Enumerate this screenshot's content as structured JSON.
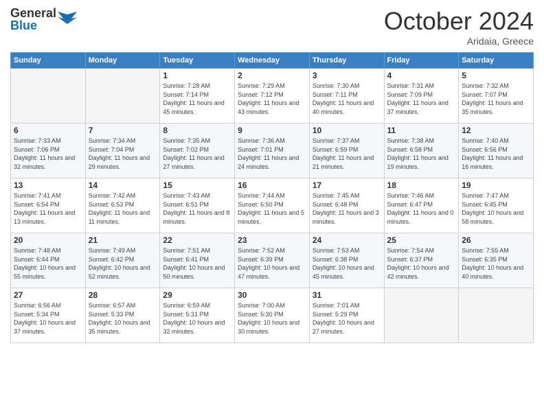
{
  "header": {
    "logo_general": "General",
    "logo_blue": "Blue",
    "month_title": "October 2024",
    "location": "Aridaia, Greece"
  },
  "days_of_week": [
    "Sunday",
    "Monday",
    "Tuesday",
    "Wednesday",
    "Thursday",
    "Friday",
    "Saturday"
  ],
  "weeks": [
    [
      {
        "num": "",
        "info": ""
      },
      {
        "num": "",
        "info": ""
      },
      {
        "num": "1",
        "info": "Sunrise: 7:28 AM\nSunset: 7:14 PM\nDaylight: 11 hours and 45 minutes."
      },
      {
        "num": "2",
        "info": "Sunrise: 7:29 AM\nSunset: 7:12 PM\nDaylight: 11 hours and 43 minutes."
      },
      {
        "num": "3",
        "info": "Sunrise: 7:30 AM\nSunset: 7:11 PM\nDaylight: 11 hours and 40 minutes."
      },
      {
        "num": "4",
        "info": "Sunrise: 7:31 AM\nSunset: 7:09 PM\nDaylight: 11 hours and 37 minutes."
      },
      {
        "num": "5",
        "info": "Sunrise: 7:32 AM\nSunset: 7:07 PM\nDaylight: 11 hours and 35 minutes."
      }
    ],
    [
      {
        "num": "6",
        "info": "Sunrise: 7:33 AM\nSunset: 7:06 PM\nDaylight: 11 hours and 32 minutes."
      },
      {
        "num": "7",
        "info": "Sunrise: 7:34 AM\nSunset: 7:04 PM\nDaylight: 11 hours and 29 minutes."
      },
      {
        "num": "8",
        "info": "Sunrise: 7:35 AM\nSunset: 7:02 PM\nDaylight: 11 hours and 27 minutes."
      },
      {
        "num": "9",
        "info": "Sunrise: 7:36 AM\nSunset: 7:01 PM\nDaylight: 11 hours and 24 minutes."
      },
      {
        "num": "10",
        "info": "Sunrise: 7:37 AM\nSunset: 6:59 PM\nDaylight: 11 hours and 21 minutes."
      },
      {
        "num": "11",
        "info": "Sunrise: 7:38 AM\nSunset: 6:58 PM\nDaylight: 11 hours and 19 minutes."
      },
      {
        "num": "12",
        "info": "Sunrise: 7:40 AM\nSunset: 6:56 PM\nDaylight: 11 hours and 16 minutes."
      }
    ],
    [
      {
        "num": "13",
        "info": "Sunrise: 7:41 AM\nSunset: 6:54 PM\nDaylight: 11 hours and 13 minutes."
      },
      {
        "num": "14",
        "info": "Sunrise: 7:42 AM\nSunset: 6:53 PM\nDaylight: 11 hours and 11 minutes."
      },
      {
        "num": "15",
        "info": "Sunrise: 7:43 AM\nSunset: 6:51 PM\nDaylight: 11 hours and 8 minutes."
      },
      {
        "num": "16",
        "info": "Sunrise: 7:44 AM\nSunset: 6:50 PM\nDaylight: 11 hours and 5 minutes."
      },
      {
        "num": "17",
        "info": "Sunrise: 7:45 AM\nSunset: 6:48 PM\nDaylight: 11 hours and 3 minutes."
      },
      {
        "num": "18",
        "info": "Sunrise: 7:46 AM\nSunset: 6:47 PM\nDaylight: 11 hours and 0 minutes."
      },
      {
        "num": "19",
        "info": "Sunrise: 7:47 AM\nSunset: 6:45 PM\nDaylight: 10 hours and 58 minutes."
      }
    ],
    [
      {
        "num": "20",
        "info": "Sunrise: 7:48 AM\nSunset: 6:44 PM\nDaylight: 10 hours and 55 minutes."
      },
      {
        "num": "21",
        "info": "Sunrise: 7:49 AM\nSunset: 6:42 PM\nDaylight: 10 hours and 52 minutes."
      },
      {
        "num": "22",
        "info": "Sunrise: 7:51 AM\nSunset: 6:41 PM\nDaylight: 10 hours and 50 minutes."
      },
      {
        "num": "23",
        "info": "Sunrise: 7:52 AM\nSunset: 6:39 PM\nDaylight: 10 hours and 47 minutes."
      },
      {
        "num": "24",
        "info": "Sunrise: 7:53 AM\nSunset: 6:38 PM\nDaylight: 10 hours and 45 minutes."
      },
      {
        "num": "25",
        "info": "Sunrise: 7:54 AM\nSunset: 6:37 PM\nDaylight: 10 hours and 42 minutes."
      },
      {
        "num": "26",
        "info": "Sunrise: 7:55 AM\nSunset: 6:35 PM\nDaylight: 10 hours and 40 minutes."
      }
    ],
    [
      {
        "num": "27",
        "info": "Sunrise: 6:56 AM\nSunset: 5:34 PM\nDaylight: 10 hours and 37 minutes."
      },
      {
        "num": "28",
        "info": "Sunrise: 6:57 AM\nSunset: 5:33 PM\nDaylight: 10 hours and 35 minutes."
      },
      {
        "num": "29",
        "info": "Sunrise: 6:59 AM\nSunset: 5:31 PM\nDaylight: 10 hours and 32 minutes."
      },
      {
        "num": "30",
        "info": "Sunrise: 7:00 AM\nSunset: 5:30 PM\nDaylight: 10 hours and 30 minutes."
      },
      {
        "num": "31",
        "info": "Sunrise: 7:01 AM\nSunset: 5:29 PM\nDaylight: 10 hours and 27 minutes."
      },
      {
        "num": "",
        "info": ""
      },
      {
        "num": "",
        "info": ""
      }
    ]
  ]
}
